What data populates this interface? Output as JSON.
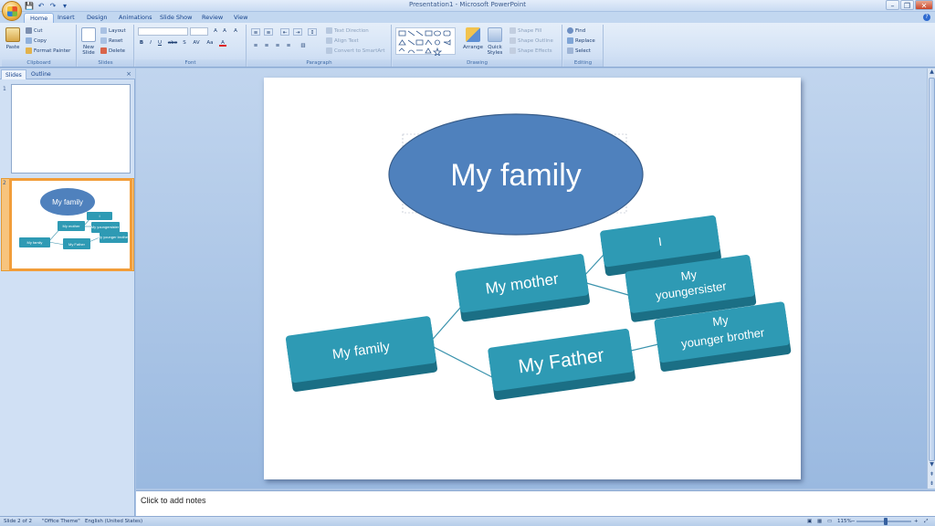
{
  "window": {
    "title": "Presentation1 - Microsoft PowerPoint",
    "help": "?"
  },
  "quick_access": {
    "save": "💾",
    "undo": "↶",
    "redo": "↷",
    "more": "▾"
  },
  "ribbon_tabs": [
    "Home",
    "Insert",
    "Design",
    "Animations",
    "Slide Show",
    "Review",
    "View"
  ],
  "ribbon": {
    "clipboard": {
      "label": "Clipboard",
      "paste": "Paste",
      "cut": "Cut",
      "copy": "Copy",
      "format_painter": "Format Painter"
    },
    "slides": {
      "label": "Slides",
      "new_slide": "New Slide",
      "layout": "Layout",
      "reset": "Reset",
      "delete": "Delete"
    },
    "font": {
      "label": "Font",
      "bold": "B",
      "italic": "I",
      "underline": "U",
      "strike": "abe",
      "shadow": "S",
      "spacing": "AV",
      "case": "Aa",
      "color": "A",
      "grow": "A",
      "shrink": "A",
      "clear": "A"
    },
    "paragraph": {
      "label": "Paragraph",
      "text_direction": "Text Direction",
      "align_text": "Align Text",
      "smartart": "Convert to SmartArt"
    },
    "drawing": {
      "label": "Drawing",
      "arrange": "Arrange",
      "quick_styles": "Quick Styles",
      "shape_fill": "Shape Fill",
      "shape_outline": "Shape Outline",
      "shape_effects": "Shape Effects"
    },
    "editing": {
      "label": "Editing",
      "find": "Find",
      "replace": "Replace",
      "select": "Select"
    }
  },
  "left_panel": {
    "tabs": [
      "Slides",
      "Outline"
    ],
    "close": "×",
    "slides": [
      {
        "number": "1"
      },
      {
        "number": "2",
        "title": "My family",
        "boxes": [
          "My family",
          "My mother",
          "My Father",
          "I",
          "My youngersister",
          "My younger brother"
        ]
      }
    ]
  },
  "slide": {
    "title": "My family",
    "root": "My family",
    "level1": [
      "My mother",
      "My Father"
    ],
    "level2": [
      "I",
      "My",
      "youngersister",
      "My",
      "younger brother"
    ]
  },
  "notes": {
    "placeholder": "Click to add notes"
  },
  "status_bar": {
    "slide_info": "Slide 2 of 2",
    "theme": "\"Office Theme\"",
    "language": "English (United States)",
    "zoom": "115%"
  },
  "colors": {
    "ellipse_fill": "#4f81bd",
    "ellipse_stroke": "#385d8a",
    "box_fill": "#2e9ab4",
    "box_side": "#1b6f85",
    "connector": "#3b93ad",
    "ribbon_bg": "#d6e4f6"
  }
}
